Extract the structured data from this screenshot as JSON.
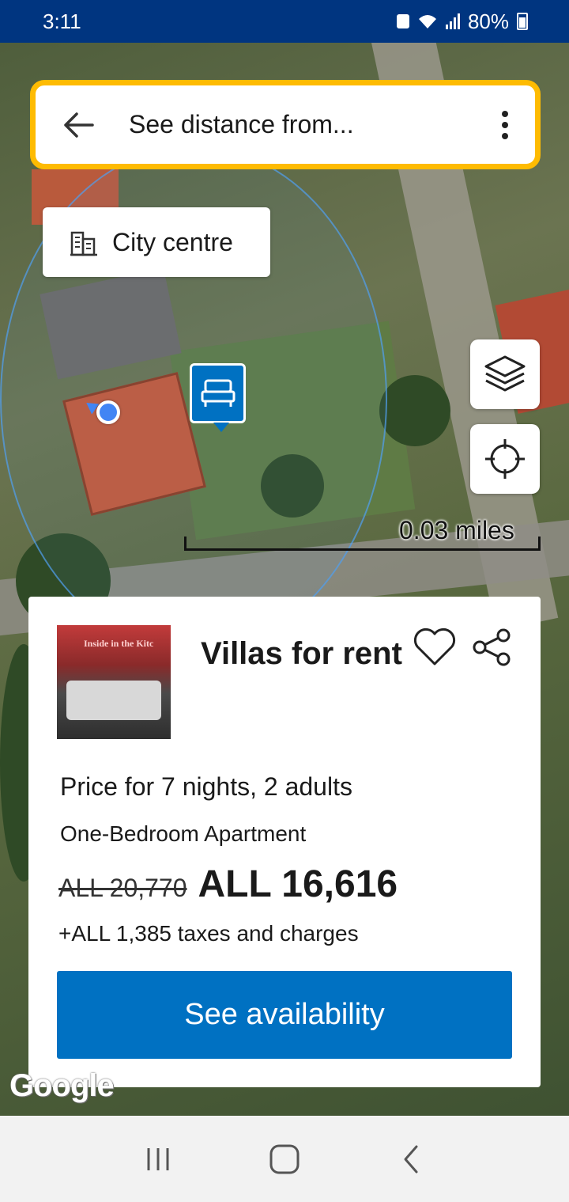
{
  "status_bar": {
    "time": "3:11",
    "battery": "80%"
  },
  "search_bar": {
    "title": "See distance from..."
  },
  "city_chip": {
    "label": "City centre"
  },
  "map": {
    "scale_label": "0.03 miles",
    "attribution": "Google"
  },
  "property_card": {
    "thumbnail_caption": "Inside in the Kitc",
    "name": "Villas for rent",
    "price_for": "Price for 7 nights, 2 adults",
    "room_type": "One-Bedroom Apartment",
    "old_price": "ALL 20,770",
    "new_price": "ALL 16,616",
    "taxes": "+ALL 1,385 taxes and charges",
    "cta_label": "See availability"
  },
  "colors": {
    "brand_blue": "#003580",
    "action_blue": "#0071c2",
    "highlight_yellow": "#febb02"
  }
}
